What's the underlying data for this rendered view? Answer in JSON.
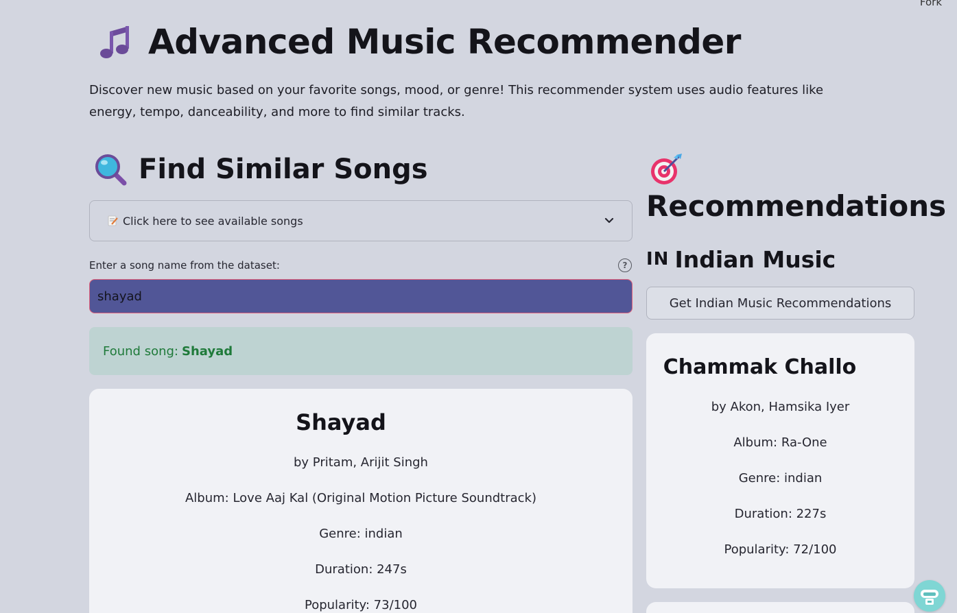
{
  "header": {
    "fork_label": "Fork",
    "title": "Advanced Music Recommender",
    "intro": "Discover new music based on your favorite songs, mood, or genre! This recommender system uses audio features like energy, tempo, danceability, and more to find similar tracks."
  },
  "find": {
    "heading": "Find Similar Songs",
    "expander_label": "Click here to see available songs",
    "input_label": "Enter a song name from the dataset:",
    "help_glyph": "?",
    "input_value": "shayad",
    "found_prefix": "Found song:",
    "found_song": "Shayad",
    "card": {
      "title": "Shayad",
      "artists": "by Pritam, Arijit Singh",
      "album": "Album: Love Aaj Kal (Original Motion Picture Soundtrack)",
      "genre": "Genre: indian",
      "duration": "Duration: 247s",
      "popularity": "Popularity: 73/100"
    }
  },
  "recommendations": {
    "heading": "Recommendations",
    "section_flag": "IN",
    "section_title": "Indian Music",
    "button_label": "Get Indian Music Recommendations",
    "card": {
      "title": "Chammak Challo",
      "artists": "by Akon, Hamsika Iyer",
      "album": "Album: Ra-One",
      "genre": "Genre: indian",
      "duration": "Duration: 227s",
      "popularity": "Popularity: 72/100"
    }
  },
  "colors": {
    "background": "#d3d6e0",
    "input_fill": "#515697",
    "input_border": "#e0607a",
    "success_bg": "#bed3d2",
    "success_text": "#1f7a3a",
    "card_bg": "#f1f2f6"
  },
  "icons": {
    "title": "musical-notes-icon",
    "find": "magnifier-icon",
    "expander": "memo-icon",
    "expander_toggle": "chevron-down-icon",
    "recommendations": "direct-hit-icon",
    "assistant": "assistant-icon"
  }
}
